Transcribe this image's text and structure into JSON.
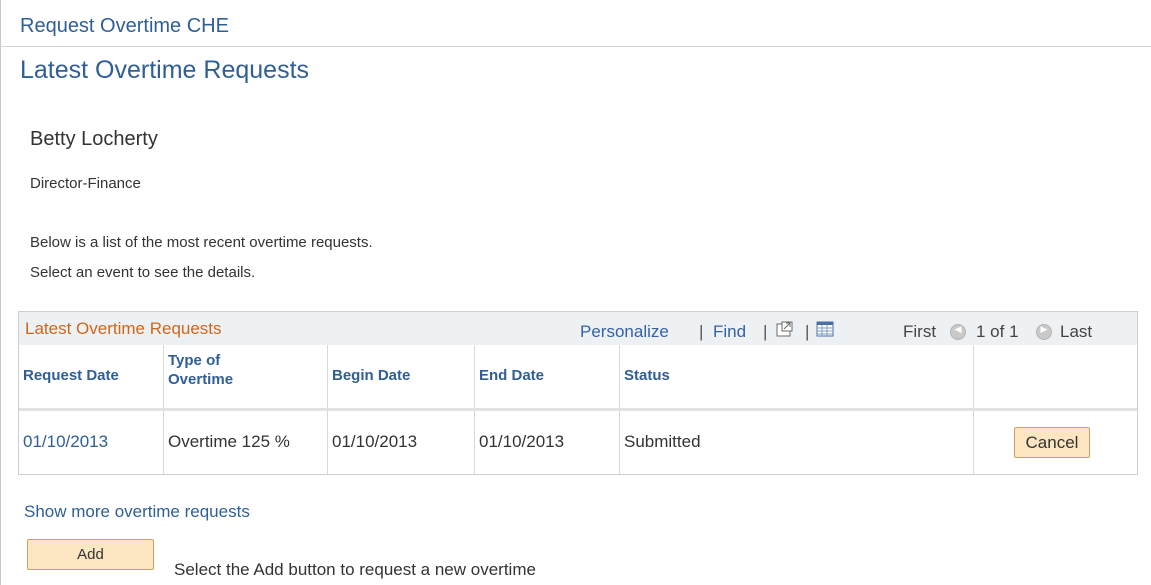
{
  "header": {
    "app_title": "Request Overtime CHE",
    "page_title": "Latest Overtime Requests"
  },
  "employee": {
    "name": "Betty Locherty",
    "job_title": "Director-Finance"
  },
  "instructions": {
    "line1": "Below is a list of the most recent overtime requests.",
    "line2": "Select an event to see the details."
  },
  "grid": {
    "title": "Latest Overtime Requests",
    "personalize_label": "Personalize",
    "find_label": "Find",
    "separator": "|",
    "first_label": "First",
    "page_info": "1 of 1",
    "last_label": "Last",
    "columns": {
      "request_date": "Request Date",
      "type_line1": "Type of",
      "type_line2": "Overtime",
      "begin_date": "Begin Date",
      "end_date": "End Date",
      "status": "Status"
    },
    "rows": [
      {
        "request_date": "01/10/2013",
        "type": "Overtime 125 %",
        "begin_date": "01/10/2013",
        "end_date": "01/10/2013",
        "status": "Submitted",
        "action": "Cancel"
      }
    ]
  },
  "footer": {
    "show_more": "Show more overtime requests",
    "add_label": "Add",
    "add_hint": "Select the Add button to request a new overtime"
  },
  "colors": {
    "link": "#2f5f96",
    "grid_title": "#d0661a",
    "button_bg": "#fbe6c1"
  }
}
